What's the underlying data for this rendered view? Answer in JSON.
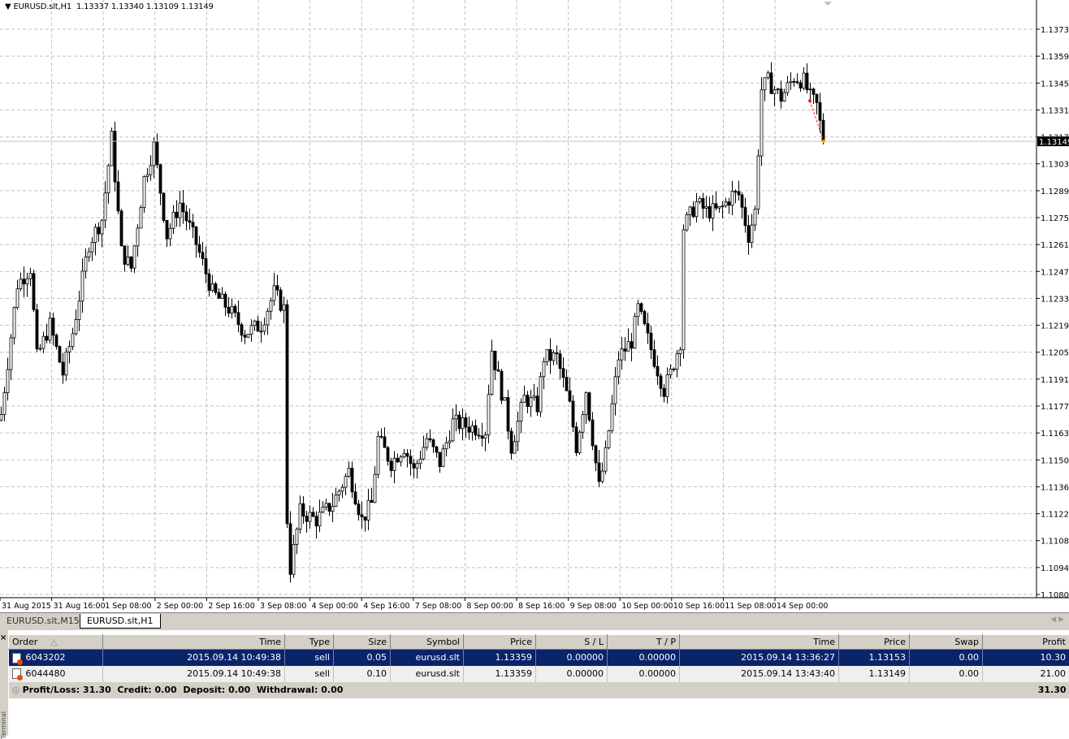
{
  "chart": {
    "title": "EURUSD.slt,H1",
    "ohlc": "1.13337 1.13340 1.13109 1.13149",
    "current_price": "1.13149",
    "colors": {
      "grid": "#c0c0c0",
      "bull_body": "#ffffff",
      "bear_body": "#000000",
      "candle_line": "#000000",
      "trade_line": "#e03010",
      "price_line": "#c0c0c0"
    }
  },
  "chart_data": {
    "type": "candlestick",
    "symbol": "EURUSD.slt",
    "timeframe": "H1",
    "ylim": [
      1.108,
      1.1373
    ],
    "y_ticks": [
      "1.13730",
      "1.13590",
      "1.13450",
      "1.13310",
      "1.13170",
      "1.13030",
      "1.12895",
      "1.12755",
      "1.12615",
      "1.12475",
      "1.12335",
      "1.12195",
      "1.12055",
      "1.11915",
      "1.11775",
      "1.11635",
      "1.11500",
      "1.11360",
      "1.11220",
      "1.11080",
      "1.10940",
      "1.10800"
    ],
    "x_ticks": [
      "31 Aug 2015",
      "31 Aug 16:00",
      "1 Sep 08:00",
      "2 Sep 00:00",
      "2 Sep 16:00",
      "3 Sep 08:00",
      "4 Sep 00:00",
      "4 Sep 16:00",
      "7 Sep 08:00",
      "8 Sep 00:00",
      "8 Sep 16:00",
      "9 Sep 08:00",
      "10 Sep 00:00",
      "10 Sep 16:00",
      "11 Sep 08:00",
      "14 Sep 00:00"
    ],
    "grid": true,
    "close_path": [
      [
        0,
        1.11734
      ],
      [
        5,
        1.12408
      ],
      [
        9,
        1.12492
      ],
      [
        11,
        1.12029
      ],
      [
        15,
        1.12198
      ],
      [
        19,
        1.11945
      ],
      [
        22,
        1.12156
      ],
      [
        27,
        1.12619
      ],
      [
        31,
        1.12745
      ],
      [
        34,
        1.13166
      ],
      [
        37,
        1.12577
      ],
      [
        40,
        1.12492
      ],
      [
        44,
        1.12955
      ],
      [
        47,
        1.13124
      ],
      [
        51,
        1.12661
      ],
      [
        55,
        1.12829
      ],
      [
        60,
        1.12619
      ],
      [
        65,
        1.12366
      ],
      [
        70,
        1.12282
      ],
      [
        75,
        1.12156
      ],
      [
        80,
        1.12198
      ],
      [
        84,
        1.12366
      ],
      [
        87,
        1.12282
      ],
      [
        88,
        1.11187
      ],
      [
        89,
        1.10935
      ],
      [
        92,
        1.11229
      ],
      [
        97,
        1.11187
      ],
      [
        102,
        1.11271
      ],
      [
        107,
        1.1144
      ],
      [
        111,
        1.11187
      ],
      [
        114,
        1.11271
      ],
      [
        116,
        1.11608
      ],
      [
        120,
        1.11482
      ],
      [
        124,
        1.11566
      ],
      [
        127,
        1.1144
      ],
      [
        131,
        1.11608
      ],
      [
        135,
        1.11482
      ],
      [
        139,
        1.11692
      ],
      [
        144,
        1.11671
      ],
      [
        149,
        1.1165
      ],
      [
        151,
        1.12071
      ],
      [
        155,
        1.11776
      ],
      [
        157,
        1.11566
      ],
      [
        161,
        1.11818
      ],
      [
        165,
        1.11776
      ],
      [
        167,
        1.12029
      ],
      [
        171,
        1.12029
      ],
      [
        175,
        1.11776
      ],
      [
        177,
        1.11566
      ],
      [
        180,
        1.1186
      ],
      [
        184,
        1.11355
      ],
      [
        186,
        1.11524
      ],
      [
        190,
        1.12029
      ],
      [
        194,
        1.12113
      ],
      [
        196,
        1.12282
      ],
      [
        200,
        1.12071
      ],
      [
        204,
        1.1186
      ],
      [
        206,
        1.11945
      ],
      [
        209,
        1.12113
      ],
      [
        210,
        1.12703
      ],
      [
        214,
        1.12829
      ],
      [
        217,
        1.12787
      ],
      [
        221,
        1.12787
      ],
      [
        225,
        1.12871
      ],
      [
        227,
        1.12871
      ],
      [
        230,
        1.12661
      ],
      [
        232,
        1.12787
      ],
      [
        234,
        1.13418
      ],
      [
        236,
        1.13461
      ],
      [
        240,
        1.13376
      ],
      [
        244,
        1.13482
      ],
      [
        247,
        1.13461
      ],
      [
        249,
        1.13376
      ],
      [
        251,
        1.13334
      ],
      [
        253,
        1.13149
      ]
    ],
    "trade_line": {
      "from_price": 1.13359,
      "to_price": 1.13149
    }
  },
  "tabs": [
    {
      "label": "EURUSD.slt,M15"
    },
    {
      "label": "EURUSD.slt,H1"
    }
  ],
  "terminal": {
    "close_label": "×",
    "side_label": "Terminal",
    "columns": [
      "Order",
      "Time",
      "Type",
      "Size",
      "Symbol",
      "Price",
      "S / L",
      "T / P",
      "Time",
      "Price",
      "Swap",
      "Profit"
    ],
    "sort_indicator": "△",
    "rows": [
      [
        "6043202",
        "2015.09.14 10:49:38",
        "sell",
        "0.05",
        "eurusd.slt",
        "1.13359",
        "0.00000",
        "0.00000",
        "2015.09.14 13:36:27",
        "1.13153",
        "0.00",
        "10.30"
      ],
      [
        "6044480",
        "2015.09.14 10:49:38",
        "sell",
        "0.10",
        "eurusd.slt",
        "1.13359",
        "0.00000",
        "0.00000",
        "2015.09.14 13:43:40",
        "1.13149",
        "0.00",
        "21.00"
      ]
    ],
    "summary": "Profit/Loss: 31.30  Credit: 0.00  Deposit: 0.00  Withdrawal: 0.00",
    "summary_total": "31.30"
  }
}
